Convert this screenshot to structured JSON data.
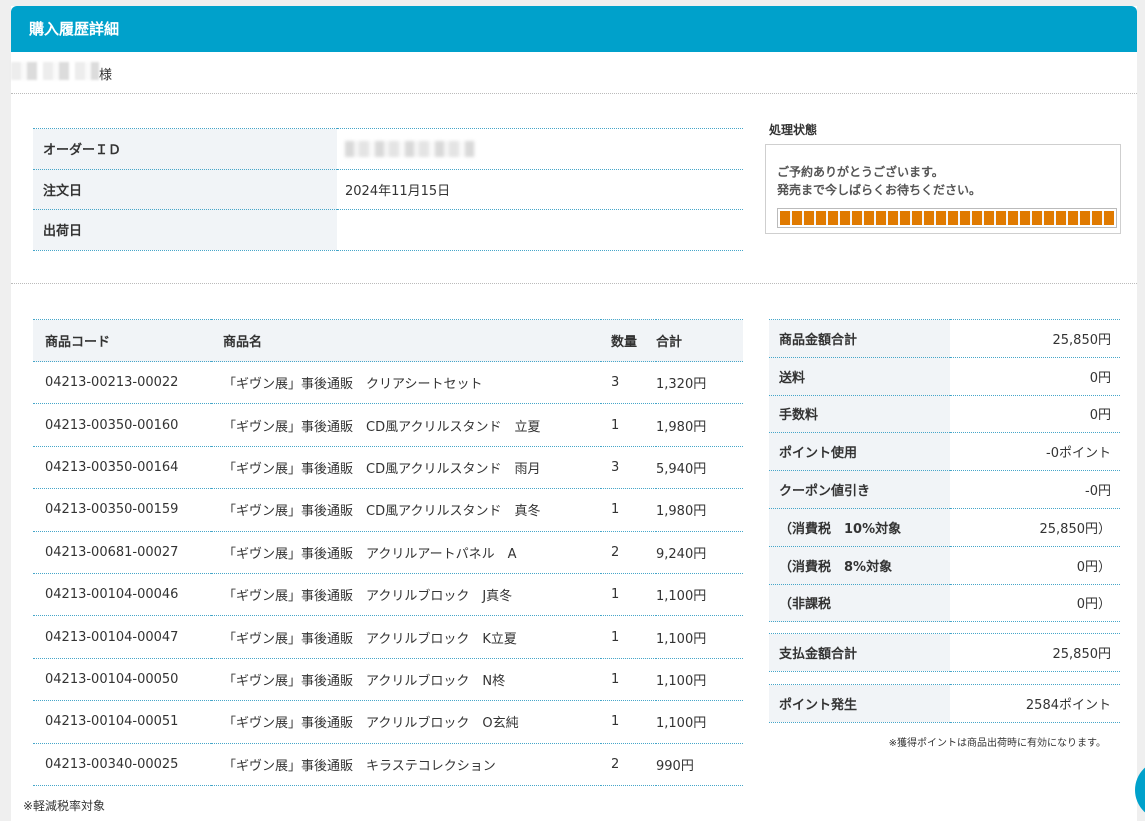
{
  "header": {
    "title": "購入履歴詳細"
  },
  "customer": {
    "suffix": "様"
  },
  "order": {
    "rows": [
      {
        "label": "オーダーＩＤ",
        "value": ""
      },
      {
        "label": "注文日",
        "value": "2024年11月15日"
      },
      {
        "label": "出荷日",
        "value": ""
      }
    ]
  },
  "status": {
    "title": "処理状態",
    "line1": "ご予約ありがとうございます。",
    "line2": "発売まで今しばらくお待ちください。"
  },
  "items": {
    "headers": {
      "code": "商品コード",
      "name": "商品名",
      "qty": "数量",
      "sum": "合計"
    },
    "rows": [
      {
        "code": "04213-00213-00022",
        "name": "「ギヴン展」事後通販　クリアシートセット",
        "qty": "3",
        "sum": "1,320円"
      },
      {
        "code": "04213-00350-00160",
        "name": "「ギヴン展」事後通販　CD風アクリルスタンド　立夏",
        "qty": "1",
        "sum": "1,980円"
      },
      {
        "code": "04213-00350-00164",
        "name": "「ギヴン展」事後通販　CD風アクリルスタンド　雨月",
        "qty": "3",
        "sum": "5,940円"
      },
      {
        "code": "04213-00350-00159",
        "name": "「ギヴン展」事後通販　CD風アクリルスタンド　真冬",
        "qty": "1",
        "sum": "1,980円"
      },
      {
        "code": "04213-00681-00027",
        "name": "「ギヴン展」事後通販　アクリルアートパネル　A",
        "qty": "2",
        "sum": "9,240円"
      },
      {
        "code": "04213-00104-00046",
        "name": "「ギヴン展」事後通販　アクリルブロック　J真冬",
        "qty": "1",
        "sum": "1,100円"
      },
      {
        "code": "04213-00104-00047",
        "name": "「ギヴン展」事後通販　アクリルブロック　K立夏",
        "qty": "1",
        "sum": "1,100円"
      },
      {
        "code": "04213-00104-00050",
        "name": "「ギヴン展」事後通販　アクリルブロック　N柊",
        "qty": "1",
        "sum": "1,100円"
      },
      {
        "code": "04213-00104-00051",
        "name": "「ギヴン展」事後通販　アクリルブロック　O玄純",
        "qty": "1",
        "sum": "1,100円"
      },
      {
        "code": "04213-00340-00025",
        "name": "「ギヴン展」事後通販　キラステコレクション",
        "qty": "2",
        "sum": "990円"
      }
    ],
    "note": "※軽減税率対象"
  },
  "summary": {
    "rows": [
      {
        "label": "商品金額合計",
        "value": "25,850円"
      },
      {
        "label": "送料",
        "value": "0円"
      },
      {
        "label": "手数料",
        "value": "0円"
      },
      {
        "label": "ポイント使用",
        "value": "-0ポイント"
      },
      {
        "label": "クーポン値引き",
        "value": "-0円"
      },
      {
        "label": "（消費税　10%対象",
        "value": "25,850円）"
      },
      {
        "label": "（消費税　8%対象",
        "value": "0円）"
      },
      {
        "label": "（非課税",
        "value": "0円）"
      }
    ],
    "total": {
      "label": "支払金額合計",
      "value": "25,850円"
    },
    "points": {
      "label": "ポイント発生",
      "value": "2584ポイント"
    },
    "note": "※獲得ポイントは商品出荷時に有効になります。"
  }
}
